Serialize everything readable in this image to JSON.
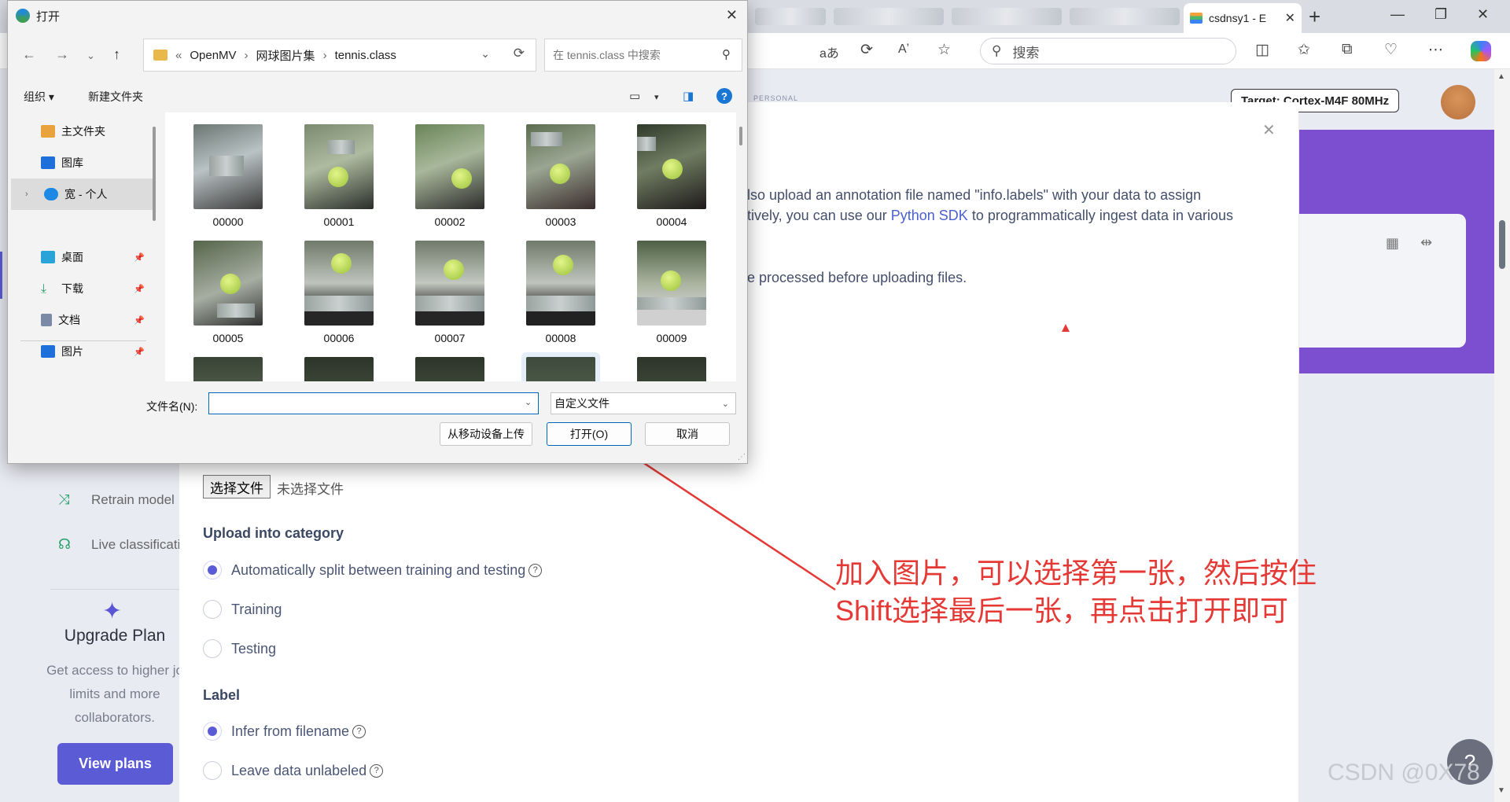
{
  "browser": {
    "active_tab_title": "csdnsy1 - E",
    "tab_close": "✕",
    "new_tab": "+",
    "search_placeholder": "搜索",
    "read_aloud": "aあ",
    "text_size": "Aʼ"
  },
  "dialog": {
    "title": "打开",
    "path": [
      "OpenMV",
      "网球图片集",
      "tennis.class"
    ],
    "path_prefix": "«",
    "search_placeholder": "在 tennis.class 中搜索",
    "organize": "组织 ▾",
    "new_folder": "新建文件夹",
    "sidebar": [
      {
        "label": "主文件夹",
        "icon_color": "#e8a33c"
      },
      {
        "label": "图库",
        "icon_color": "#1e6fd9"
      },
      {
        "label": "宽 - 个人",
        "icon_color": "#1e88e5"
      },
      {
        "label": "桌面",
        "icon_color": "#2aa3d8"
      },
      {
        "label": "下载",
        "icon_color": "#2aa36a"
      },
      {
        "label": "文档",
        "icon_color": "#7a8aa6"
      },
      {
        "label": "图片",
        "icon_color": "#1e6fd9"
      }
    ],
    "files": [
      "00000",
      "00001",
      "00002",
      "00003",
      "00004",
      "00005",
      "00006",
      "00007",
      "00008",
      "00009"
    ],
    "filename_label": "文件名(N):",
    "filename_value": "",
    "filetype": "自定义文件",
    "upload_mobile_btn": "从移动设备上传",
    "open_btn": "打开(O)",
    "cancel_btn": "取消"
  },
  "header": {
    "target": "Target: Cortex-M4F 80MHz",
    "personal": "PERSONAL"
  },
  "modal": {
    "line1": "lso upload an annotation file named \"info.labels\" with your data to assign",
    "line2_pre": "tively, you can use our ",
    "line2_link": "Python SDK",
    "line2_post": " to programmatically ingest data in various",
    "line3": "e processed before uploading files.",
    "choose_file": "选择文件",
    "no_file": "未选择文件",
    "upload_category_title": "Upload into category",
    "categories": [
      {
        "label": "Automatically split between training and testing",
        "checked": true,
        "help": true
      },
      {
        "label": "Training",
        "checked": false,
        "help": false
      },
      {
        "label": "Testing",
        "checked": false,
        "help": false
      }
    ],
    "label_title": "Label",
    "label_options": [
      {
        "label": "Infer from filename",
        "checked": true,
        "help": true
      },
      {
        "label": "Leave data unlabeled",
        "checked": false,
        "help": true
      }
    ]
  },
  "sidebar": {
    "nav": [
      {
        "label": "Retrain model",
        "icon": "shuffle-icon"
      },
      {
        "label": "Live classificati",
        "icon": "live-icon"
      }
    ],
    "upgrade_title": "Upgrade Plan",
    "upgrade_desc": "Get access to higher jo limits and more collaborators.",
    "view_plans": "View plans"
  },
  "annotation": {
    "line1": "加入图片，可以选择第一张，然后按住",
    "line2": "Shift选择最后一张，再点击打开即可",
    "color": "#e53935"
  },
  "watermark": "CSDN @0X78"
}
